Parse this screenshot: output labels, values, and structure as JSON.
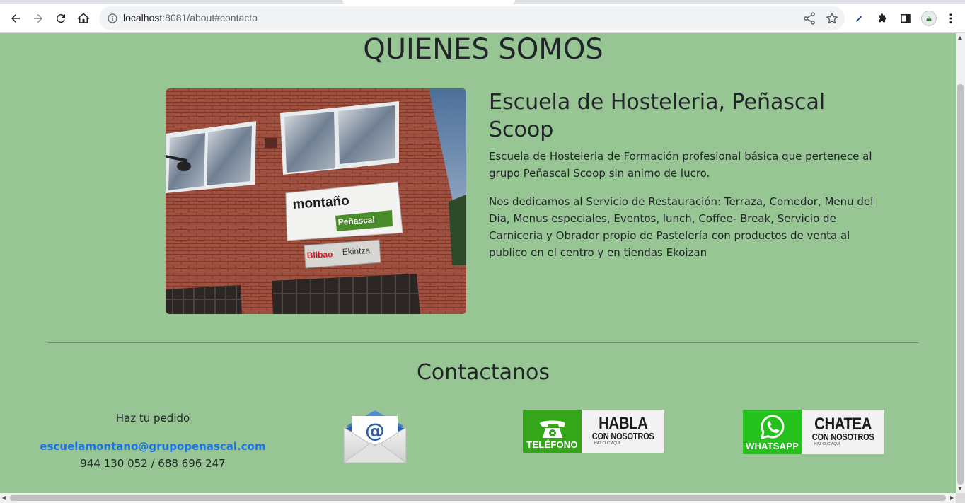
{
  "browser": {
    "url_host": "localhost",
    "url_rest": ":8081/about#contacto",
    "icons": [
      "back-icon",
      "forward-icon",
      "reload-icon",
      "home-icon",
      "info-icon",
      "share-icon",
      "bookmark-star-icon",
      "pen-extension-icon",
      "puzzle-extensions-icon",
      "side-panel-icon",
      "profile-avatar",
      "kebab-menu-icon"
    ]
  },
  "page": {
    "background": "#98c594",
    "title": "QUIENES SOMOS",
    "about": {
      "heading": "Escuela de Hosteleria, Peñascal Scoop",
      "paragraph1": "Escuela de Hosteleria de Formación profesional básica que pertenece al grupo Peñascal Scoop sin animo de lucro.",
      "paragraph2": "Nos dedicamos al Servicio de Restauración: Terraza, Comedor, Menu del Dia, Menus especiales, Eventos, lunch, Coffee- Break, Servicio de Carniceria y Obrador propio de Pastelería con productos de venta al publico en el centro y en tiendas Ekoizan"
    },
    "photo": {
      "sign_montano": "montaño",
      "sign_penascal": "Peñascal",
      "sign_bilbao": "Bilbao",
      "sign_ekintza": "Ekintza"
    },
    "contact": {
      "title": "Contactanos",
      "order_lead": "Haz tu pedido",
      "email": "escuelamontano@grupopenascal.com",
      "phones": "944 130 052 / 688 696 247",
      "call_button": {
        "left_label": "TELÉFONO",
        "big": "HABLA",
        "small": "CON NOSOTROS",
        "tiny": "HAZ CLIC AQUÍ"
      },
      "whatsapp_button": {
        "left_label": "WHATSAPP",
        "big": "CHATEA",
        "small": "CON NOSOTROS",
        "tiny": "HAZ CLIC AQUÍ"
      }
    }
  }
}
